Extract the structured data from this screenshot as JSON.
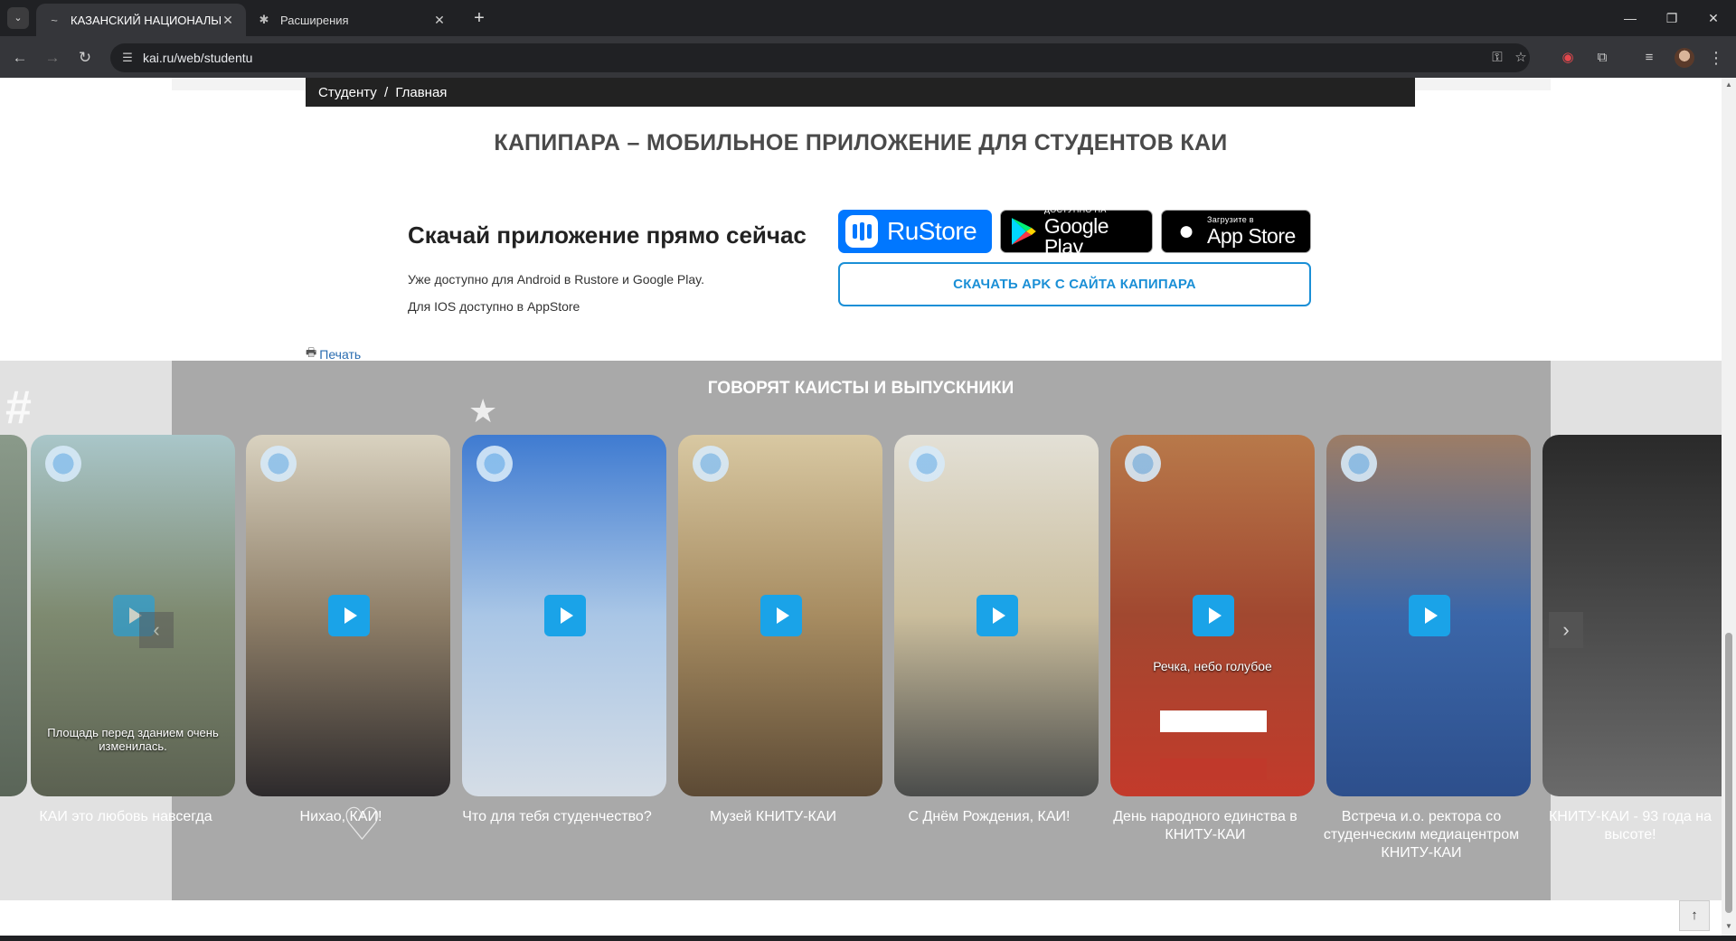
{
  "browser": {
    "tabs": [
      {
        "title": "КАЗАНСКИЙ НАЦИОНАЛЬНЫЙ",
        "active": true
      },
      {
        "title": "Расширения",
        "active": false
      }
    ],
    "url": "kai.ru/web/studentu",
    "window_controls": [
      "—",
      "❐",
      "✕"
    ]
  },
  "page": {
    "breadcrumb": {
      "parent": "Студенту",
      "separator": "/",
      "current": "Главная"
    },
    "app_section": {
      "title": "КАПИПАРА – МОБИЛЬНОЕ ПРИЛОЖЕНИЕ ДЛЯ СТУДЕНТОВ КАИ",
      "heading": "Скачай приложение прямо сейчас",
      "line1": "Уже доступно для Android в Rustore и Google Play.",
      "line2": "Для IOS доступно в AppStore",
      "rustore_label": "RuStore",
      "gplay_small": "ДОСТУПНО НА",
      "gplay_big": "Google Play",
      "appstore_small": "Загрузите в",
      "appstore_big": "App Store",
      "apk_button": "СКАЧАТЬ APK С САЙТА КАПИПАРА"
    },
    "print_label": "Печать",
    "testimonials": {
      "title": "ГОВОРЯТ КАИСТЫ И ВЫПУСКНИКИ",
      "cards": [
        {
          "caption": "КАИ это любовь навсегда",
          "overlay": "Площадь перед зданием очень изменилась.",
          "colors": [
            "#a9c6c9",
            "#7e8a70",
            "#5b6151"
          ]
        },
        {
          "caption": "Нихао, КАИ!",
          "overlay": "",
          "colors": [
            "#d9d2c0",
            "#8f7f68",
            "#2d2a2c"
          ]
        },
        {
          "caption": "Что для тебя студенчество?",
          "overlay": "",
          "colors": [
            "#3f7bd1",
            "#a9c6e6",
            "#d5dde6"
          ]
        },
        {
          "caption": "Музей КНИТУ-КАИ",
          "overlay": "",
          "colors": [
            "#d8c8a2",
            "#a78c61",
            "#5c4a35"
          ]
        },
        {
          "caption": "С Днём Рождения, КАИ!",
          "overlay": "",
          "colors": [
            "#e3e0d6",
            "#cabd9c",
            "#4a4c4b"
          ]
        },
        {
          "caption": "День народного единства в КНИТУ-КАИ",
          "overlay": "Речка, небо голубое",
          "colors": [
            "#b8794a",
            "#a14830",
            "#c33a2b"
          ]
        },
        {
          "caption": "Встреча и.о. ректора со студенческим медиацентром КНИТУ-КАИ",
          "overlay": "",
          "colors": [
            "#9d7d66",
            "#3b66a8",
            "#2d4f8c"
          ]
        },
        {
          "caption": "КНИТУ-КАИ - 93 года на высоте!",
          "overlay": "",
          "colors": [
            "#2a2a2a",
            "#4a4a4a",
            "#6a6a6a"
          ]
        }
      ]
    },
    "to_top": "↑"
  }
}
